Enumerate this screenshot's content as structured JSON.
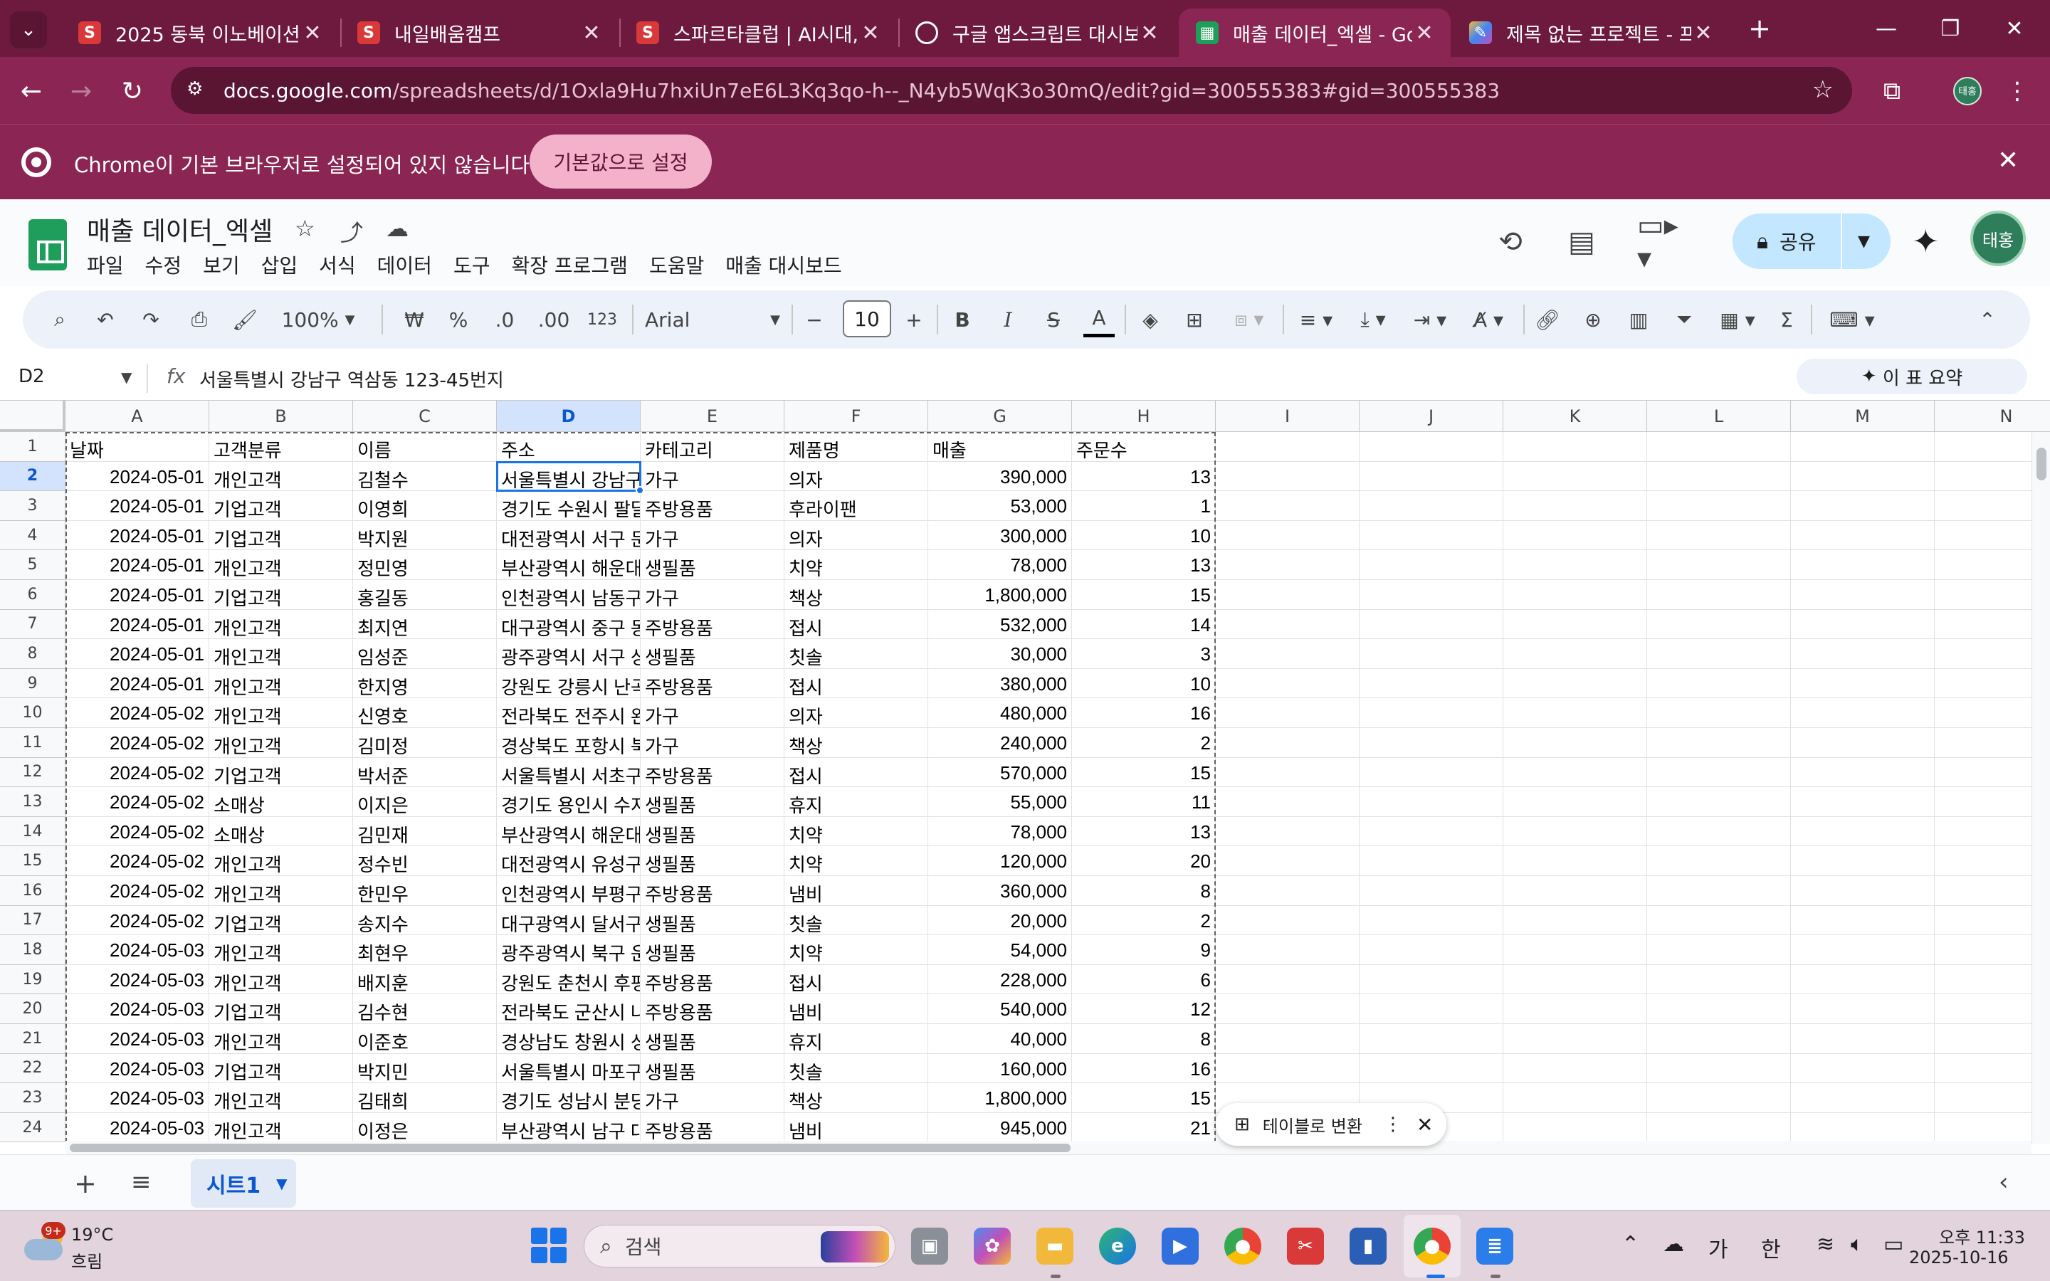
{
  "browser": {
    "tabs": [
      {
        "title": "2025 동북 이노베이션",
        "favicon": "S",
        "favicon_color": "#d93939"
      },
      {
        "title": "내일배움캠프",
        "favicon": "S",
        "favicon_color": "#d93939"
      },
      {
        "title": "스파르타클럽 | AI시대,",
        "favicon": "S",
        "favicon_color": "#d93939"
      },
      {
        "title": "구글 앱스크립트 대시보",
        "favicon": "⟲",
        "favicon_color": "#6e1a3f"
      },
      {
        "title": "매출 데이터_엑셀 - Goo",
        "favicon": "▦",
        "favicon_color": "#1e9e5a"
      },
      {
        "title": "제목 없는 프로젝트 - 프",
        "favicon": "✎",
        "favicon_color": "#6e1a3f"
      }
    ],
    "active_tab_index": 4,
    "url_host": "docs.google.com",
    "url_path": "/spreadsheets/d/1Oxla9Hu7hxiUn7eE6L3Kq3qo-h--_N4yb5WqK3o30mQ/edit?gid=300555383#gid=300555383",
    "infobar_message": "Chrome이 기본 브라우저로 설정되어 있지 않습니다",
    "infobar_button": "기본값으로 설정",
    "profile_initials": "태홍"
  },
  "sheets": {
    "doc_title": "매출 데이터_엑셀",
    "menu": [
      "파일",
      "수정",
      "보기",
      "삽입",
      "서식",
      "데이터",
      "도구",
      "확장 프로그램",
      "도움말",
      "매출 대시보드"
    ],
    "share_label": "공유",
    "account_initials": "태홍",
    "toolbar": {
      "zoom": "100%",
      "currency": "₩",
      "percent": "%",
      "dec_decrease": ".0",
      "dec_increase": ".00",
      "number_format": "123",
      "font": "Arial",
      "font_size": "10"
    },
    "name_box": "D2",
    "formula": "서울특별시 강남구 역삼동 123-45번지",
    "summary_button": "이 표 요약",
    "columns": [
      "A",
      "B",
      "C",
      "D",
      "E",
      "F",
      "G",
      "H",
      "I",
      "J",
      "K",
      "L",
      "M",
      "N"
    ],
    "selected_column": "D",
    "selected_row": 2,
    "header_row": [
      "날짜",
      "고객분류",
      "이름",
      "주소",
      "카테고리",
      "제품명",
      "매출",
      "주문수"
    ],
    "rows": [
      [
        "2024-05-01",
        "개인고객",
        "김철수",
        "서울특별시 강남구",
        "가구",
        "의자",
        "390,000",
        "13"
      ],
      [
        "2024-05-01",
        "기업고객",
        "이영희",
        "경기도 수원시 팔달",
        "주방용품",
        "후라이팬",
        "53,000",
        "1"
      ],
      [
        "2024-05-01",
        "기업고객",
        "박지원",
        "대전광역시 서구 둔",
        "가구",
        "의자",
        "300,000",
        "10"
      ],
      [
        "2024-05-01",
        "개인고객",
        "정민영",
        "부산광역시 해운대",
        "생필품",
        "치약",
        "78,000",
        "13"
      ],
      [
        "2024-05-01",
        "기업고객",
        "홍길동",
        "인천광역시 남동구",
        "가구",
        "책상",
        "1,800,000",
        "15"
      ],
      [
        "2024-05-01",
        "개인고객",
        "최지연",
        "대구광역시 중구 동",
        "주방용품",
        "접시",
        "532,000",
        "14"
      ],
      [
        "2024-05-01",
        "개인고객",
        "임성준",
        "광주광역시 서구 상",
        "생필품",
        "칫솔",
        "30,000",
        "3"
      ],
      [
        "2024-05-01",
        "개인고객",
        "한지영",
        "강원도 강릉시 난곡",
        "주방용품",
        "접시",
        "380,000",
        "10"
      ],
      [
        "2024-05-02",
        "개인고객",
        "신영호",
        "전라북도 전주시 완",
        "가구",
        "의자",
        "480,000",
        "16"
      ],
      [
        "2024-05-02",
        "개인고객",
        "김미정",
        "경상북도 포항시 북",
        "가구",
        "책상",
        "240,000",
        "2"
      ],
      [
        "2024-05-02",
        "기업고객",
        "박서준",
        "서울특별시 서초구",
        "주방용품",
        "접시",
        "570,000",
        "15"
      ],
      [
        "2024-05-02",
        "소매상",
        "이지은",
        "경기도 용인시 수지",
        "생필품",
        "휴지",
        "55,000",
        "11"
      ],
      [
        "2024-05-02",
        "소매상",
        "김민재",
        "부산광역시 해운대",
        "생필품",
        "치약",
        "78,000",
        "13"
      ],
      [
        "2024-05-02",
        "개인고객",
        "정수빈",
        "대전광역시 유성구",
        "생필품",
        "치약",
        "120,000",
        "20"
      ],
      [
        "2024-05-02",
        "개인고객",
        "한민우",
        "인천광역시 부평구",
        "주방용품",
        "냄비",
        "360,000",
        "8"
      ],
      [
        "2024-05-02",
        "기업고객",
        "송지수",
        "대구광역시 달서구",
        "생필품",
        "칫솔",
        "20,000",
        "2"
      ],
      [
        "2024-05-03",
        "개인고객",
        "최현우",
        "광주광역시 북구 운",
        "생필품",
        "치약",
        "54,000",
        "9"
      ],
      [
        "2024-05-03",
        "개인고객",
        "배지훈",
        "강원도 춘천시 후평",
        "주방용품",
        "접시",
        "228,000",
        "6"
      ],
      [
        "2024-05-03",
        "기업고객",
        "김수현",
        "전라북도 군산시 나",
        "주방용품",
        "냄비",
        "540,000",
        "12"
      ],
      [
        "2024-05-03",
        "개인고객",
        "이준호",
        "경상남도 창원시 성",
        "생필품",
        "휴지",
        "40,000",
        "8"
      ],
      [
        "2024-05-03",
        "기업고객",
        "박지민",
        "서울특별시 마포구",
        "생필품",
        "칫솔",
        "160,000",
        "16"
      ],
      [
        "2024-05-03",
        "개인고객",
        "김태희",
        "경기도 성남시 분당",
        "가구",
        "책상",
        "1,800,000",
        "15"
      ],
      [
        "2024-05-03",
        "개인고객",
        "이정은",
        "부산광역시 남구 대",
        "주방용품",
        "냄비",
        "945,000",
        "21"
      ]
    ],
    "table_chip_label": "테이블로 변환",
    "sheet_tab": "시트1"
  },
  "taskbar": {
    "weather_temp": "19°C",
    "weather_desc": "흐림",
    "weather_badge": "9+",
    "search_placeholder": "검색",
    "ime_mode": "가",
    "ime_lang": "한",
    "clock_time": "오후 11:33",
    "clock_date": "2025-10-16"
  },
  "colors": {
    "chrome_frame": "#6e1a3f",
    "chrome_toolbar": "#8b2553",
    "selection": "#1a73e8",
    "sheets_green": "#1e9e5a",
    "share_button": "#c2e7ff"
  }
}
